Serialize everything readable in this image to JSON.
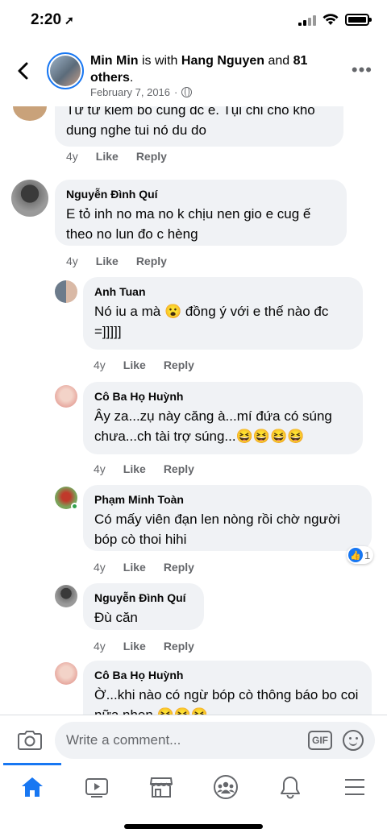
{
  "status": {
    "time": "2:20",
    "location_icon": "➚"
  },
  "header": {
    "author": "Min Min",
    "with_text": "is with",
    "tagged": "Hang Nguyen",
    "and_text": "and",
    "others": "81 others",
    "period": ".",
    "date": "February 7, 2016",
    "separator": "·",
    "more": "•••"
  },
  "comments": [
    {
      "author": "",
      "text": "Từ từ kiếm bồ cũng đc e. Tụi chỉ cho khỏ dung nghe tui nó du do",
      "time": "4y",
      "like": "Like",
      "reply": "Reply"
    },
    {
      "author": "Nguyễn Đình Quí",
      "text": "E tỏ inh no ma no k chịu nen gio e cug ế theo no lun đo c hèng",
      "time": "4y",
      "like": "Like",
      "reply": "Reply"
    },
    {
      "author": "Anh Tuan",
      "text": "Nó iu a mà",
      "emoji": "😮",
      "text2": "đồng ý với e thế nào đc =]]]]]",
      "time": "4y",
      "like": "Like",
      "reply": "Reply"
    },
    {
      "author": "Cô Ba Họ Huỳnh",
      "text": "Ây za...zụ này căng à...mí đứa có súng chưa...ch tài trợ súng...",
      "emoji": "😆😆😆😆",
      "time": "4y",
      "like": "Like",
      "reply": "Reply"
    },
    {
      "author": "Phạm Minh Toàn",
      "text": "Có mấy viên đạn len nòng rồi chờ người bóp cò thoi hihi",
      "time": "4y",
      "like": "Like",
      "reply": "Reply",
      "reaction_count": "1"
    },
    {
      "author": "Nguyễn Đình Quí",
      "text": "Đù căn",
      "time": "4y",
      "like": "Like",
      "reply": "Reply"
    },
    {
      "author": "Cô Ba Họ Huỳnh",
      "text": "Ờ...khi nào có ngừ bóp cò thông báo bo coi nữa nhen",
      "emoji": "😆😆😆",
      "time": "",
      "like": "",
      "reply": ""
    }
  ],
  "composer": {
    "placeholder": "Write a comment...",
    "gif": "GIF"
  },
  "tabs": [
    "home",
    "watch",
    "marketplace",
    "groups",
    "notifications",
    "menu"
  ]
}
